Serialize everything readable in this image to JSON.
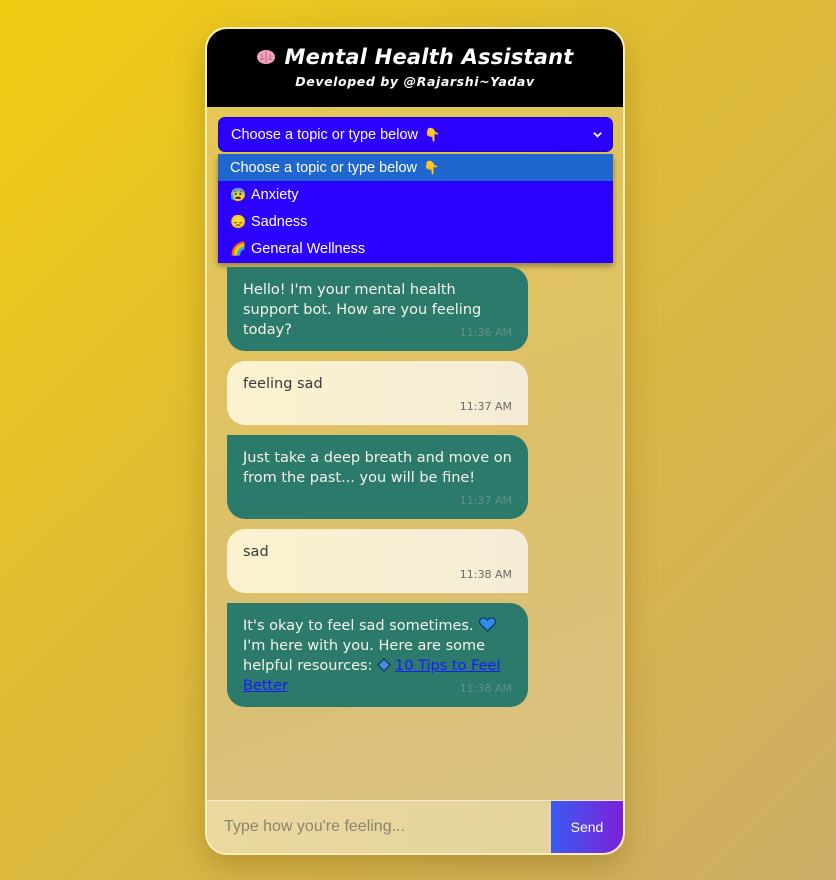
{
  "header": {
    "title": "Mental Health Assistant",
    "subtitle": "Developed by @Rajarshi~Yadav",
    "title_icon": "brain-icon"
  },
  "topic_select": {
    "selected_label": "Choose a topic or type below",
    "options": [
      {
        "label": "Choose a topic or type below",
        "icon": "pointing-down-emoji",
        "selected": true
      },
      {
        "label": "Anxiety",
        "icon": "anxious-face-emoji"
      },
      {
        "label": "Sadness",
        "icon": "sad-face-emoji"
      },
      {
        "label": "General Wellness",
        "icon": "rainbow-emoji"
      }
    ]
  },
  "messages": [
    {
      "sender": "bot",
      "text": "Hello! I'm your mental health support bot. How are you feeling today?",
      "time": "11:36 AM"
    },
    {
      "sender": "user",
      "text": "feeling sad",
      "time": "11:37 AM"
    },
    {
      "sender": "bot",
      "text": "Just take a deep breath and move on from the past... you will be fine!",
      "time": "11:37 AM"
    },
    {
      "sender": "user",
      "text": "sad",
      "time": "11:38 AM"
    },
    {
      "sender": "bot",
      "text_before": "It's okay to feel sad sometimes.",
      "text_middle": "I'm here with you. Here are some helpful resources:",
      "link_text": "10 Tips to Feel Better",
      "time": "11:38 AM"
    }
  ],
  "input": {
    "placeholder": "Type how you're feeling...",
    "value": ""
  },
  "send_button": {
    "label": "Send"
  },
  "colors": {
    "header_bg": "#000000",
    "select_bg": "#2b00ff",
    "select_highlight": "#1f66cf",
    "bot_bubble": "#2c7a6b",
    "user_bubble": "#fbf2cf",
    "link": "#1a1aff",
    "send_gradient_start": "#3a5bf2",
    "send_gradient_end": "#7c20d8"
  }
}
